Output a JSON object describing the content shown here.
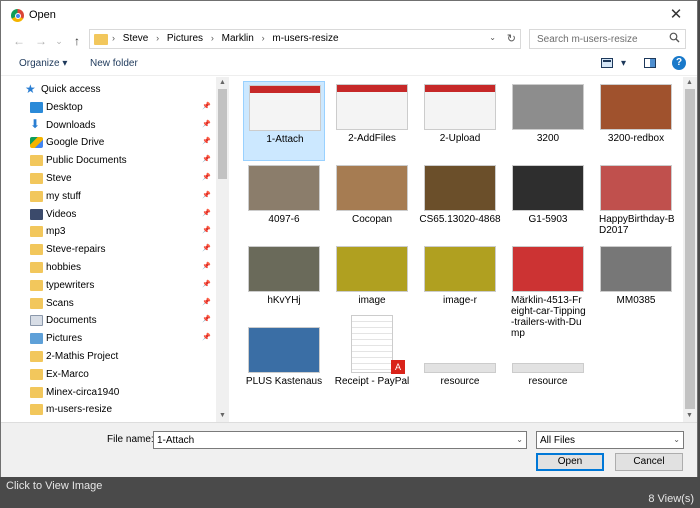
{
  "window": {
    "title": "Open",
    "close": "✕"
  },
  "nav_buttons": {
    "back": "←",
    "forward": "→",
    "dropdown": "⌄",
    "up": "↑"
  },
  "address": {
    "crumbs": [
      "Steve",
      "Pictures",
      "Marklin",
      "m-users-resize"
    ],
    "separator": "›",
    "dropdown": "⌄",
    "refresh": "↻"
  },
  "search": {
    "placeholder": "Search m-users-resize",
    "icon": "search-icon"
  },
  "toolbar": {
    "organize": "Organize ▾",
    "new_folder": "New folder",
    "view": "▾",
    "help": "?"
  },
  "sidebar": {
    "items": [
      {
        "label": "Quick access",
        "pinned": false,
        "icon": "star-icon"
      },
      {
        "label": "Desktop",
        "pinned": true,
        "icon": "desktop-icon"
      },
      {
        "label": "Downloads",
        "pinned": true,
        "icon": "download-icon"
      },
      {
        "label": "Google Drive",
        "pinned": true,
        "icon": "drive-icon"
      },
      {
        "label": "Public Documents",
        "pinned": true,
        "icon": "folder-icon"
      },
      {
        "label": "Steve",
        "pinned": true,
        "icon": "folder-icon"
      },
      {
        "label": "my stuff",
        "pinned": true,
        "icon": "folder-icon"
      },
      {
        "label": "Videos",
        "pinned": true,
        "icon": "video-icon"
      },
      {
        "label": "mp3",
        "pinned": true,
        "icon": "folder-icon"
      },
      {
        "label": "Steve-repairs",
        "pinned": true,
        "icon": "folder-icon"
      },
      {
        "label": "hobbies",
        "pinned": true,
        "icon": "folder-icon"
      },
      {
        "label": "typewriters",
        "pinned": true,
        "icon": "folder-icon"
      },
      {
        "label": "Scans",
        "pinned": true,
        "icon": "folder-icon"
      },
      {
        "label": "Documents",
        "pinned": true,
        "icon": "documents-icon"
      },
      {
        "label": "Pictures",
        "pinned": true,
        "icon": "pictures-icon"
      },
      {
        "label": "2-Mathis Project",
        "pinned": false,
        "icon": "folder-icon"
      },
      {
        "label": "Ex-Marco",
        "pinned": false,
        "icon": "folder-icon"
      },
      {
        "label": "Minex-circa1940",
        "pinned": false,
        "icon": "folder-icon"
      },
      {
        "label": "m-users-resize",
        "pinned": false,
        "icon": "folder-icon"
      }
    ]
  },
  "files": [
    {
      "name": "1-Attach",
      "selected": true,
      "color": "#c62828"
    },
    {
      "name": "2-AddFiles",
      "selected": false,
      "color": "#c62828"
    },
    {
      "name": "2-Upload",
      "selected": false,
      "color": "#c62828"
    },
    {
      "name": "3200",
      "selected": false,
      "color": "#8d8d8d"
    },
    {
      "name": "3200-redbox",
      "selected": false,
      "color": "#a0522d"
    },
    {
      "name": "4097-6",
      "selected": false,
      "color": "#8b7d6b"
    },
    {
      "name": "Cocopan",
      "selected": false,
      "color": "#a67c52"
    },
    {
      "name": "CS65.13020-4868",
      "selected": false,
      "color": "#6b4f2a"
    },
    {
      "name": "G1-5903",
      "selected": false,
      "color": "#2e2e2e"
    },
    {
      "name": "HappyBirthday-BD2017",
      "selected": false,
      "color": "#c0504d"
    },
    {
      "name": "hKvYHj",
      "selected": false,
      "color": "#6a6a5a"
    },
    {
      "name": "image",
      "selected": false,
      "color": "#b0a020"
    },
    {
      "name": "image-r",
      "selected": false,
      "color": "#b0a020"
    },
    {
      "name": "Märklin-4513-Freight-car-Tipping-trailers-with-Dump",
      "selected": false,
      "color": "#cc3333"
    },
    {
      "name": "MM0385",
      "selected": false,
      "color": "#777777"
    },
    {
      "name": "PLUS Kastenaus",
      "selected": false,
      "color": "#3a6ea5"
    },
    {
      "name": "Receipt - PayPal",
      "selected": false,
      "color": "#ffffff"
    },
    {
      "name": "resource",
      "selected": false,
      "color": "#dddddd"
    },
    {
      "name": "resource",
      "selected": false,
      "color": "#dddddd"
    }
  ],
  "footer": {
    "filename_label": "File name:",
    "filename_value": "1-Attach",
    "filetype": "All Files",
    "open": "Open",
    "cancel": "Cancel",
    "dropdown": "⌄"
  },
  "viewer": {
    "click_text": "Click to View Image",
    "views": "8 View(s)"
  }
}
